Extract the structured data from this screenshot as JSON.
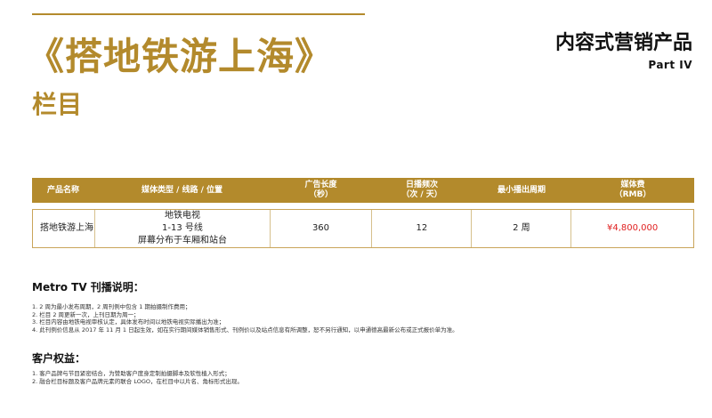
{
  "header": {
    "title": "《搭地铁游上海》",
    "subtitle": "栏目",
    "right_title": "内容式营销产品",
    "part": "Part IV"
  },
  "table": {
    "headers": [
      "产品名称",
      "媒体类型 / 线路 / 位置",
      "广告长度\n（秒）",
      "日播频次\n（次 / 天）",
      "最小播出周期",
      "媒体费\n（RMB）"
    ],
    "row": {
      "name": "搭地铁游上海",
      "media_lines": [
        "地铁电视",
        "1-13 号线",
        "屏幕分布于车厢和站台"
      ],
      "length": "360",
      "frequency": "12",
      "period": "2 周",
      "price": "¥4,800,000"
    }
  },
  "notes_section": {
    "title": "Metro TV 刊播说明：",
    "items": [
      "1. 2 周为最小发布周期，2 周刊例中包含 1 期拍摄制作费用；",
      "2. 栏目 2 周更新一次，上刊日期为周一；",
      "3. 栏目内容由地铁电视审核认定，具体发布时间以地铁电视实际播出为准；",
      "4. 此刊例价信息从 2017 年 11 月 1 日起生效，如在实行期间媒体销售形式、刊例价以及站点信息有所调整，恕不另行通知，以申通德高最新公布或正式报价单为准。"
    ]
  },
  "benefits_section": {
    "title": "客户权益：",
    "items": [
      "1. 客户品牌与节目紧密结合，为赞助客户度身定制拍摄脚本及软性植入形式；",
      "2. 融合栏目标题及客户品牌元素的联合 LOGO，在栏目中以片名、角标形式出现。"
    ]
  },
  "colors": {
    "accent": "#b38a2c",
    "price": "#e02020"
  }
}
